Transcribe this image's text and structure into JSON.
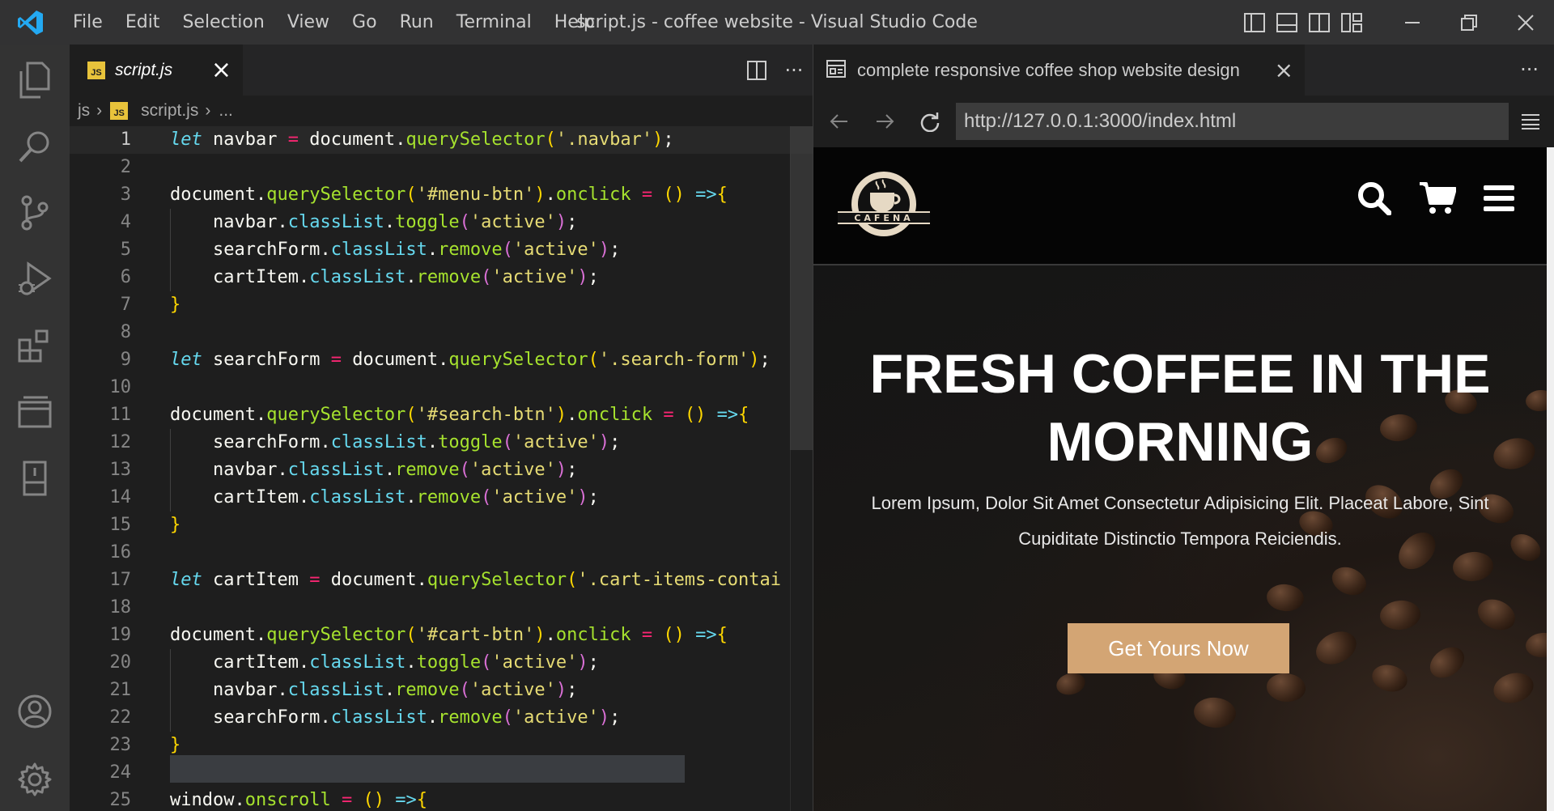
{
  "window": {
    "title": "script.js - coffee website - Visual Studio Code",
    "menu": [
      "File",
      "Edit",
      "Selection",
      "View",
      "Go",
      "Run",
      "Terminal",
      "Help"
    ]
  },
  "editor": {
    "tab_label": "script.js",
    "tab_badge": "JS",
    "breadcrumb": {
      "folder": "js",
      "file": "script.js",
      "more": "..."
    },
    "more_actions": "···"
  },
  "code_lines": [
    {
      "n": "1",
      "current": true,
      "tokens": [
        [
          "k",
          "let"
        ],
        [
          "v",
          " navbar "
        ],
        [
          "o",
          "="
        ],
        [
          "v",
          " document"
        ],
        [
          "pc",
          "."
        ],
        [
          "f",
          "querySelector"
        ],
        [
          "b1",
          "("
        ],
        [
          "s",
          "'.navbar'"
        ],
        [
          "b1",
          ")"
        ],
        [
          "pc",
          ";"
        ]
      ]
    },
    {
      "n": "2",
      "tokens": []
    },
    {
      "n": "3",
      "tokens": [
        [
          "v",
          "document"
        ],
        [
          "pc",
          "."
        ],
        [
          "f",
          "querySelector"
        ],
        [
          "b1",
          "("
        ],
        [
          "s",
          "'#menu-btn'"
        ],
        [
          "b1",
          ")"
        ],
        [
          "pc",
          "."
        ],
        [
          "f",
          "onclick"
        ],
        [
          "v",
          " "
        ],
        [
          "o",
          "="
        ],
        [
          "v",
          " "
        ],
        [
          "b1",
          "()"
        ],
        [
          "v",
          " "
        ],
        [
          "p",
          "=>"
        ],
        [
          "b1",
          "{"
        ]
      ]
    },
    {
      "n": "4",
      "indent": true,
      "tokens": [
        [
          "v",
          "    navbar"
        ],
        [
          "pc",
          "."
        ],
        [
          "p",
          "classList"
        ],
        [
          "pc",
          "."
        ],
        [
          "f",
          "toggle"
        ],
        [
          "b2",
          "("
        ],
        [
          "s",
          "'active'"
        ],
        [
          "b2",
          ")"
        ],
        [
          "pc",
          ";"
        ]
      ]
    },
    {
      "n": "5",
      "indent": true,
      "tokens": [
        [
          "v",
          "    searchForm"
        ],
        [
          "pc",
          "."
        ],
        [
          "p",
          "classList"
        ],
        [
          "pc",
          "."
        ],
        [
          "f",
          "remove"
        ],
        [
          "b2",
          "("
        ],
        [
          "s",
          "'active'"
        ],
        [
          "b2",
          ")"
        ],
        [
          "pc",
          ";"
        ]
      ]
    },
    {
      "n": "6",
      "indent": true,
      "tokens": [
        [
          "v",
          "    cartItem"
        ],
        [
          "pc",
          "."
        ],
        [
          "p",
          "classList"
        ],
        [
          "pc",
          "."
        ],
        [
          "f",
          "remove"
        ],
        [
          "b2",
          "("
        ],
        [
          "s",
          "'active'"
        ],
        [
          "b2",
          ")"
        ],
        [
          "pc",
          ";"
        ]
      ]
    },
    {
      "n": "7",
      "tokens": [
        [
          "b1",
          "}"
        ]
      ]
    },
    {
      "n": "8",
      "tokens": []
    },
    {
      "n": "9",
      "tokens": [
        [
          "k",
          "let"
        ],
        [
          "v",
          " searchForm "
        ],
        [
          "o",
          "="
        ],
        [
          "v",
          " document"
        ],
        [
          "pc",
          "."
        ],
        [
          "f",
          "querySelector"
        ],
        [
          "b1",
          "("
        ],
        [
          "s",
          "'.search-form'"
        ],
        [
          "b1",
          ")"
        ],
        [
          "pc",
          ";"
        ]
      ]
    },
    {
      "n": "10",
      "tokens": []
    },
    {
      "n": "11",
      "tokens": [
        [
          "v",
          "document"
        ],
        [
          "pc",
          "."
        ],
        [
          "f",
          "querySelector"
        ],
        [
          "b1",
          "("
        ],
        [
          "s",
          "'#search-btn'"
        ],
        [
          "b1",
          ")"
        ],
        [
          "pc",
          "."
        ],
        [
          "f",
          "onclick"
        ],
        [
          "v",
          " "
        ],
        [
          "o",
          "="
        ],
        [
          "v",
          " "
        ],
        [
          "b1",
          "()"
        ],
        [
          "v",
          " "
        ],
        [
          "p",
          "=>"
        ],
        [
          "b1",
          "{"
        ]
      ]
    },
    {
      "n": "12",
      "indent": true,
      "tokens": [
        [
          "v",
          "    searchForm"
        ],
        [
          "pc",
          "."
        ],
        [
          "p",
          "classList"
        ],
        [
          "pc",
          "."
        ],
        [
          "f",
          "toggle"
        ],
        [
          "b2",
          "("
        ],
        [
          "s",
          "'active'"
        ],
        [
          "b2",
          ")"
        ],
        [
          "pc",
          ";"
        ]
      ]
    },
    {
      "n": "13",
      "indent": true,
      "tokens": [
        [
          "v",
          "    navbar"
        ],
        [
          "pc",
          "."
        ],
        [
          "p",
          "classList"
        ],
        [
          "pc",
          "."
        ],
        [
          "f",
          "remove"
        ],
        [
          "b2",
          "("
        ],
        [
          "s",
          "'active'"
        ],
        [
          "b2",
          ")"
        ],
        [
          "pc",
          ";"
        ]
      ]
    },
    {
      "n": "14",
      "indent": true,
      "tokens": [
        [
          "v",
          "    cartItem"
        ],
        [
          "pc",
          "."
        ],
        [
          "p",
          "classList"
        ],
        [
          "pc",
          "."
        ],
        [
          "f",
          "remove"
        ],
        [
          "b2",
          "("
        ],
        [
          "s",
          "'active'"
        ],
        [
          "b2",
          ")"
        ],
        [
          "pc",
          ";"
        ]
      ]
    },
    {
      "n": "15",
      "tokens": [
        [
          "b1",
          "}"
        ]
      ]
    },
    {
      "n": "16",
      "tokens": []
    },
    {
      "n": "17",
      "tokens": [
        [
          "k",
          "let"
        ],
        [
          "v",
          " cartItem "
        ],
        [
          "o",
          "="
        ],
        [
          "v",
          " document"
        ],
        [
          "pc",
          "."
        ],
        [
          "f",
          "querySelector"
        ],
        [
          "b1",
          "("
        ],
        [
          "s",
          "'.cart-items-contai"
        ]
      ]
    },
    {
      "n": "18",
      "tokens": []
    },
    {
      "n": "19",
      "tokens": [
        [
          "v",
          "document"
        ],
        [
          "pc",
          "."
        ],
        [
          "f",
          "querySelector"
        ],
        [
          "b1",
          "("
        ],
        [
          "s",
          "'#cart-btn'"
        ],
        [
          "b1",
          ")"
        ],
        [
          "pc",
          "."
        ],
        [
          "f",
          "onclick"
        ],
        [
          "v",
          " "
        ],
        [
          "o",
          "="
        ],
        [
          "v",
          " "
        ],
        [
          "b1",
          "()"
        ],
        [
          "v",
          " "
        ],
        [
          "p",
          "=>"
        ],
        [
          "b1",
          "{"
        ]
      ]
    },
    {
      "n": "20",
      "indent": true,
      "tokens": [
        [
          "v",
          "    cartItem"
        ],
        [
          "pc",
          "."
        ],
        [
          "p",
          "classList"
        ],
        [
          "pc",
          "."
        ],
        [
          "f",
          "toggle"
        ],
        [
          "b2",
          "("
        ],
        [
          "s",
          "'active'"
        ],
        [
          "b2",
          ")"
        ],
        [
          "pc",
          ";"
        ]
      ]
    },
    {
      "n": "21",
      "indent": true,
      "tokens": [
        [
          "v",
          "    navbar"
        ],
        [
          "pc",
          "."
        ],
        [
          "p",
          "classList"
        ],
        [
          "pc",
          "."
        ],
        [
          "f",
          "remove"
        ],
        [
          "b2",
          "("
        ],
        [
          "s",
          "'active'"
        ],
        [
          "b2",
          ")"
        ],
        [
          "pc",
          ";"
        ]
      ]
    },
    {
      "n": "22",
      "indent": true,
      "tokens": [
        [
          "v",
          "    searchForm"
        ],
        [
          "pc",
          "."
        ],
        [
          "p",
          "classList"
        ],
        [
          "pc",
          "."
        ],
        [
          "f",
          "remove"
        ],
        [
          "b2",
          "("
        ],
        [
          "s",
          "'active'"
        ],
        [
          "b2",
          ")"
        ],
        [
          "pc",
          ";"
        ]
      ]
    },
    {
      "n": "23",
      "tokens": [
        [
          "b1",
          "}"
        ]
      ]
    },
    {
      "n": "24",
      "tokens": []
    },
    {
      "n": "25",
      "tokens": [
        [
          "v",
          "window"
        ],
        [
          "pc",
          "."
        ],
        [
          "f",
          "onscroll"
        ],
        [
          "v",
          " "
        ],
        [
          "o",
          "="
        ],
        [
          "v",
          " "
        ],
        [
          "b1",
          "()"
        ],
        [
          "v",
          " "
        ],
        [
          "p",
          "=>"
        ],
        [
          "b1",
          "{"
        ]
      ]
    }
  ],
  "preview": {
    "tab_label": "complete responsive coffee shop website design",
    "url": "http://127.0.0.1:3000/index.html",
    "more_actions": "···",
    "site": {
      "logo_text": "CAFENA",
      "hero_title": "FRESH COFFEE IN THE MORNING",
      "hero_text": "Lorem Ipsum, Dolor Sit Amet Consectetur Adipisicing Elit. Placeat Labore, Sint Cupiditate Distinctio Tempora Reiciendis.",
      "button_label": "Get Yours Now"
    }
  },
  "colors": {
    "accent_button": "#d3a574",
    "vscode_blue": "#23a9f2",
    "js_badge": "#e8c33b"
  }
}
